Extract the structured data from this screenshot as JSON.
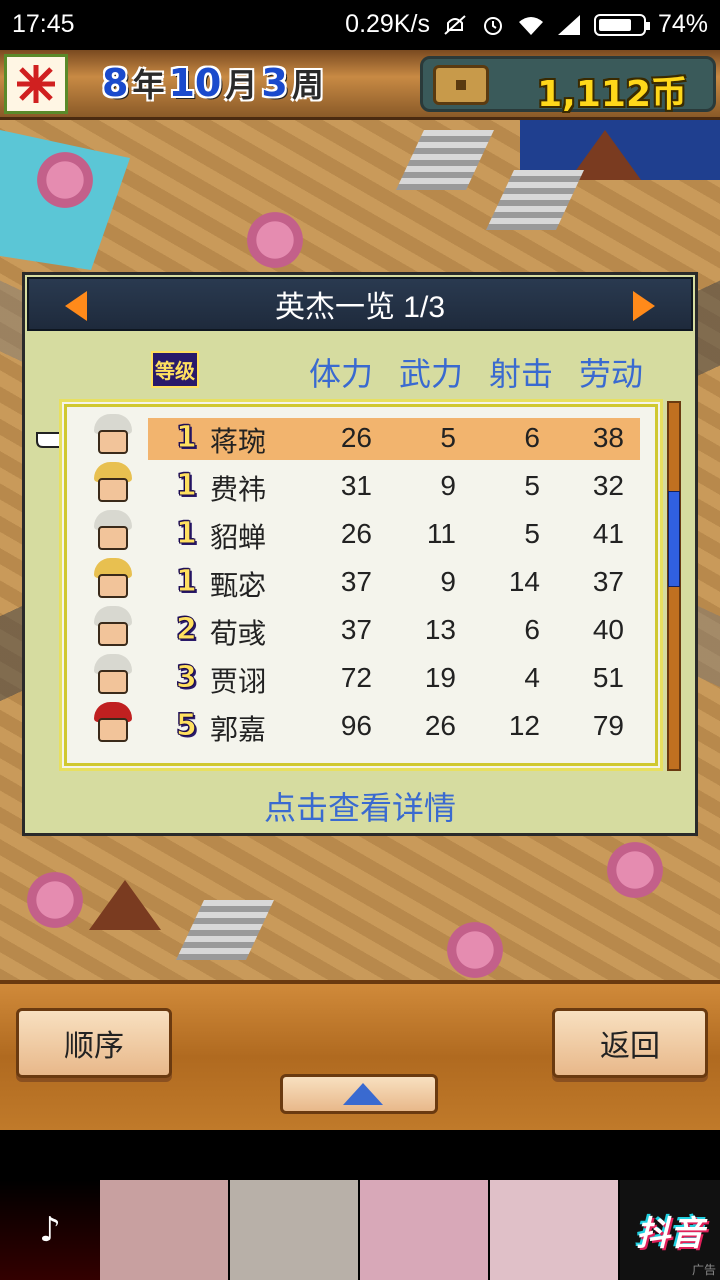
{
  "status": {
    "time": "17:45",
    "speed": "0.29K/s",
    "battery": "74%"
  },
  "hud": {
    "year_num": "8",
    "year_unit": "年",
    "month_num": "10",
    "month_unit": "月",
    "week_num": "3",
    "week_unit": "周",
    "money": "1,112币"
  },
  "panel": {
    "title": "英杰一览 1/3",
    "level_header": "等级",
    "columns": [
      "体力",
      "武力",
      "射击",
      "劳动"
    ],
    "rows": [
      {
        "level": "1",
        "name": "蒋琬",
        "vals": [
          "26",
          "5",
          "6",
          "38"
        ],
        "selected": true,
        "hair": "#d8d8d0"
      },
      {
        "level": "1",
        "name": "费祎",
        "vals": [
          "31",
          "9",
          "5",
          "32"
        ],
        "selected": false,
        "hair": "#e8c050"
      },
      {
        "level": "1",
        "name": "貂蝉",
        "vals": [
          "26",
          "11",
          "5",
          "41"
        ],
        "selected": false,
        "hair": "#d8d8d0"
      },
      {
        "level": "1",
        "name": "甄宓",
        "vals": [
          "37",
          "9",
          "14",
          "37"
        ],
        "selected": false,
        "hair": "#e8c050"
      },
      {
        "level": "2",
        "name": "荀彧",
        "vals": [
          "37",
          "13",
          "6",
          "40"
        ],
        "selected": false,
        "hair": "#d8d8d0"
      },
      {
        "level": "3",
        "name": "贾诩",
        "vals": [
          "72",
          "19",
          "4",
          "51"
        ],
        "selected": false,
        "hair": "#d8d8d0"
      },
      {
        "level": "5",
        "name": "郭嘉",
        "vals": [
          "96",
          "26",
          "12",
          "79"
        ],
        "selected": false,
        "hair": "#c02020"
      }
    ],
    "hint": "点击查看详情"
  },
  "bottom": {
    "order_label": "顺序",
    "back_label": "返回"
  },
  "ad": {
    "brand": "抖音",
    "tag": "广告"
  },
  "colors": {
    "accent_blue": "#3a6ad0",
    "selected_row": "#f2b46e",
    "money_yellow": "#ffd81a"
  }
}
